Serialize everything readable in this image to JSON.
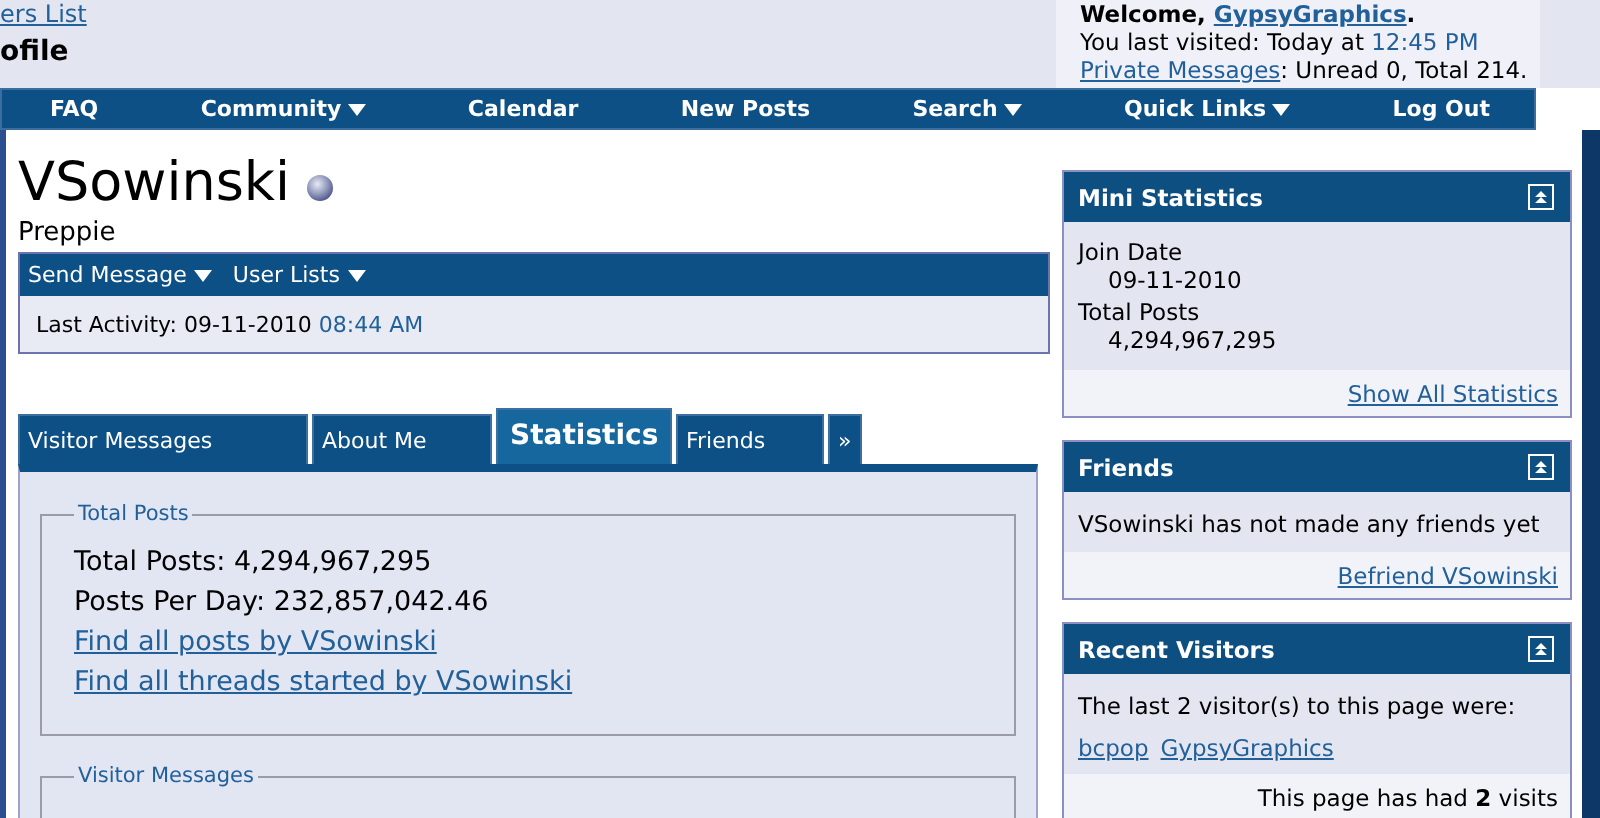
{
  "header": {
    "breadcrumb_link": "ers List",
    "page_title": "ofile",
    "welcome": {
      "prefix": "Welcome, ",
      "user": "GypsyGraphics",
      "suffix": "."
    },
    "last_visited": {
      "label": "You last visited: Today at",
      "time": "12:45 PM"
    },
    "private_messages": {
      "link": "Private Messages",
      "text": ": Unread 0, Total 214."
    }
  },
  "navbar": [
    {
      "label": "FAQ",
      "dropdown": false
    },
    {
      "label": "Community",
      "dropdown": true
    },
    {
      "label": "Calendar",
      "dropdown": false
    },
    {
      "label": "New Posts",
      "dropdown": false
    },
    {
      "label": "Search",
      "dropdown": true
    },
    {
      "label": "Quick Links",
      "dropdown": true
    },
    {
      "label": "Log Out",
      "dropdown": false
    }
  ],
  "profile": {
    "username": "VSowinski",
    "title": "Preppie",
    "actions": [
      {
        "label": "Send Message",
        "dropdown": true
      },
      {
        "label": "User Lists",
        "dropdown": true
      }
    ],
    "last_activity": {
      "label": "Last Activity: 09-11-2010",
      "time": "08:44 AM"
    }
  },
  "tabs": [
    {
      "label": "Visitor Messages",
      "selected": false
    },
    {
      "label": "About Me",
      "selected": false
    },
    {
      "label": "Statistics",
      "selected": true
    },
    {
      "label": "Friends",
      "selected": false
    },
    {
      "label": "»",
      "selected": false
    }
  ],
  "statistics": [
    {
      "legend": "Total Posts",
      "lines": [
        {
          "kind": "text",
          "text": "Total Posts: 4,294,967,295"
        },
        {
          "kind": "text",
          "text": "Posts Per Day: 232,857,042.46"
        },
        {
          "kind": "link",
          "text": "Find all posts by VSowinski"
        },
        {
          "kind": "link",
          "text": "Find all threads started by VSowinski"
        }
      ]
    },
    {
      "legend": "Visitor Messages"
    }
  ],
  "sidebar": [
    {
      "title": "Mini Statistics",
      "stats": [
        {
          "label": "Join Date",
          "value": "09-11-2010"
        },
        {
          "label": "Total Posts",
          "value": "4,294,967,295"
        }
      ],
      "footer_link": "Show All Statistics"
    },
    {
      "title": "Friends",
      "text": "VSowinski has not made any friends yet",
      "footer_link": "Befriend VSowinski"
    },
    {
      "title": "Recent Visitors",
      "text": "The last 2 visitor(s) to this page were:",
      "links": [
        "bcpop",
        "GypsyGraphics"
      ],
      "footer_text": "This page has had **2** visits"
    }
  ]
}
